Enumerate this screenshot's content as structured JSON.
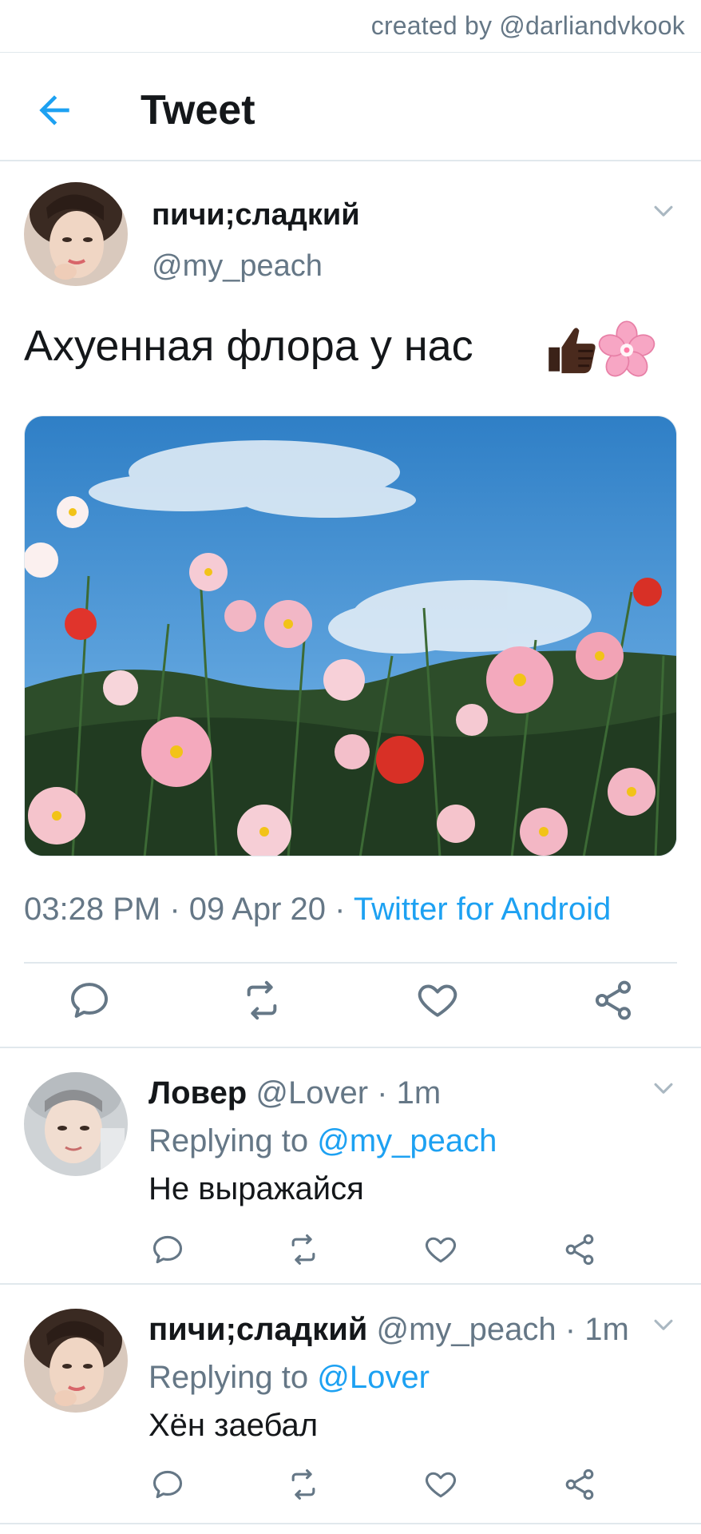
{
  "watermark": "created by @darliandvkook",
  "header": {
    "title": "Tweet"
  },
  "main_tweet": {
    "author_name": "пичи;сладкий",
    "author_handle": "@my_peach",
    "text": "Ахуенная флора у нас",
    "emojis": [
      "thumbs-up-dark-emoji",
      "cherry-blossom-emoji"
    ],
    "time": "03:28 PM",
    "date": "09 Apr 20",
    "separator": "·",
    "source": "Twitter for Android"
  },
  "replies": [
    {
      "author_name": "Ловер",
      "author_handle": "@Lover",
      "age": "1m",
      "replying_label": "Replying to",
      "replying_to": "@my_peach",
      "text": "Не выражайся"
    },
    {
      "author_name": "пичи;сладкий",
      "author_handle": "@my_peach",
      "age": "1m",
      "replying_label": "Replying to",
      "replying_to": "@Lover",
      "text": "Хён заебал"
    }
  ],
  "icons": {
    "back": "arrow-left-icon",
    "menu": "chevron-down-icon",
    "reply": "reply-icon",
    "retweet": "retweet-icon",
    "like": "heart-icon",
    "share": "share-icon"
  },
  "colors": {
    "accent": "#1da1f2",
    "secondary_text": "#657786",
    "primary_text": "#14171a",
    "divider": "#e1e8ed"
  }
}
